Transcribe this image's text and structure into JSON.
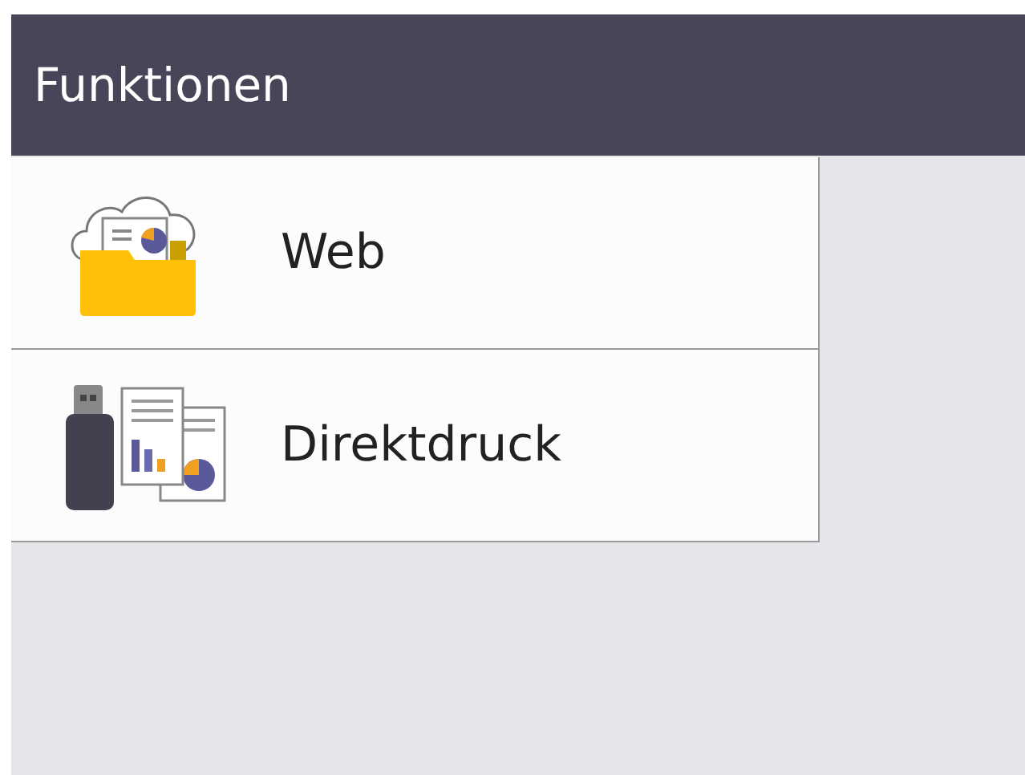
{
  "header": {
    "title": "Funktionen"
  },
  "items": [
    {
      "label": "Web",
      "kind": "web"
    },
    {
      "label": "Direktdruck",
      "kind": "direct-print"
    }
  ]
}
